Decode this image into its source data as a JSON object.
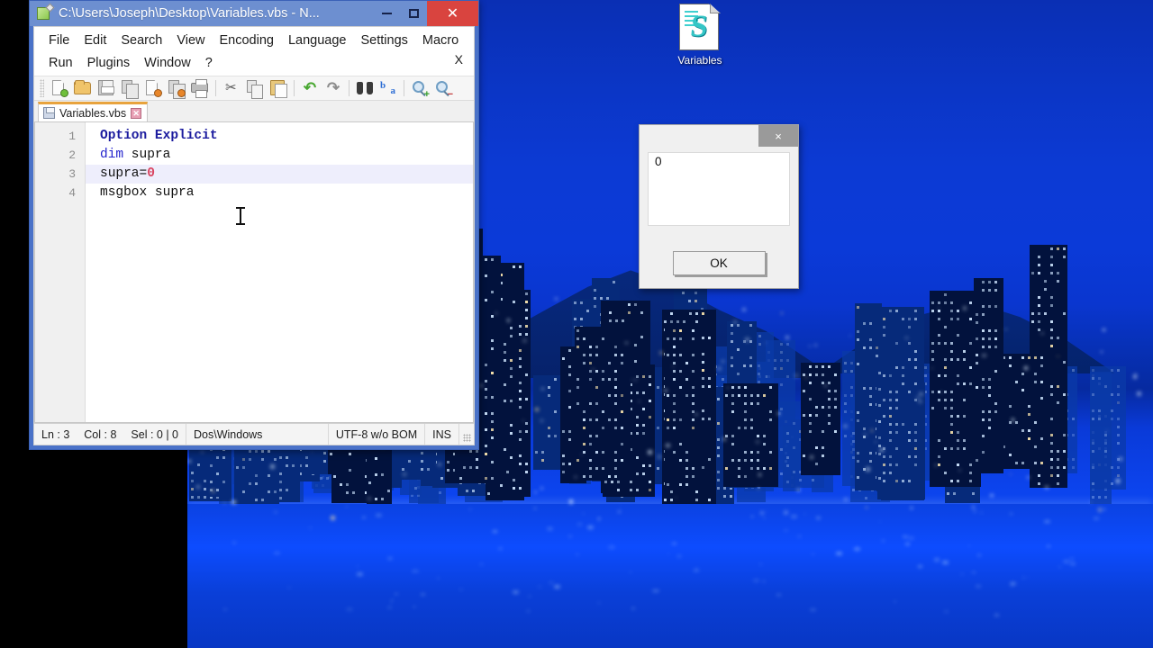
{
  "desktop": {
    "icon": {
      "label": "Variables",
      "icon_name": "vbscript-file-icon"
    }
  },
  "editor_window": {
    "title": "C:\\Users\\Joseph\\Desktop\\Variables.vbs - N...",
    "app_icon": "notepad-plus-plus-icon",
    "window_controls": {
      "minimize": "–",
      "maximize": "☐",
      "close": "×"
    },
    "menu": {
      "row1": [
        "File",
        "Edit",
        "Search",
        "View",
        "Encoding",
        "Language",
        "Settings",
        "Macro"
      ],
      "row2": [
        "Run",
        "Plugins",
        "Window",
        "?"
      ],
      "doc_close": "X"
    },
    "toolbar": [
      {
        "name": "new-file-icon",
        "tip": "New"
      },
      {
        "name": "open-file-icon",
        "tip": "Open"
      },
      {
        "name": "save-icon",
        "tip": "Save"
      },
      {
        "name": "save-all-icon",
        "tip": "Save All"
      },
      {
        "name": "close-file-icon",
        "tip": "Close"
      },
      {
        "name": "close-all-icon",
        "tip": "Close All"
      },
      {
        "name": "print-icon",
        "tip": "Print"
      },
      {
        "name": "cut-icon",
        "tip": "Cut"
      },
      {
        "name": "copy-icon",
        "tip": "Copy"
      },
      {
        "name": "paste-icon",
        "tip": "Paste"
      },
      {
        "name": "undo-icon",
        "tip": "Undo"
      },
      {
        "name": "redo-icon",
        "tip": "Redo"
      },
      {
        "name": "find-icon",
        "tip": "Find"
      },
      {
        "name": "replace-icon",
        "tip": "Replace"
      },
      {
        "name": "zoom-in-icon",
        "tip": "Zoom In"
      },
      {
        "name": "zoom-out-icon",
        "tip": "Zoom Out"
      }
    ],
    "tabs": [
      {
        "label": "Variables.vbs",
        "close": "✕",
        "active": true
      }
    ],
    "code": {
      "lines": [
        {
          "num": "1",
          "tokens": [
            {
              "t": "Option Explicit",
              "c": "kw"
            }
          ],
          "active": false
        },
        {
          "num": "2",
          "tokens": [
            {
              "t": "dim",
              "c": "kw2"
            },
            {
              "t": " supra",
              "c": ""
            }
          ],
          "active": false
        },
        {
          "num": "3",
          "tokens": [
            {
              "t": "supra=",
              "c": ""
            },
            {
              "t": "0",
              "c": "num"
            }
          ],
          "active": true
        },
        {
          "num": "4",
          "tokens": [
            {
              "t": "msgbox supra",
              "c": ""
            }
          ],
          "active": false
        }
      ]
    },
    "status_bar": {
      "line": "Ln : 3",
      "col": "Col : 8",
      "sel": "Sel : 0 | 0",
      "eol": "Dos\\Windows",
      "encoding": "UTF-8 w/o BOM",
      "insert_mode": "INS"
    }
  },
  "message_box": {
    "title": "",
    "close_label": "×",
    "body_text": "0",
    "ok_label": "OK"
  },
  "colors": {
    "title_bar": "#6d8fd0",
    "window_frame": "#4a72c8",
    "close_button": "#d9443f",
    "tab_active_top": "#e8a33d",
    "keyword": "#1b1b9e",
    "number_literal": "#d9435f",
    "active_line": "#eeeefc",
    "desktop_blue": "#0c3ad4",
    "msgbox_close": "#9a9a9a"
  }
}
